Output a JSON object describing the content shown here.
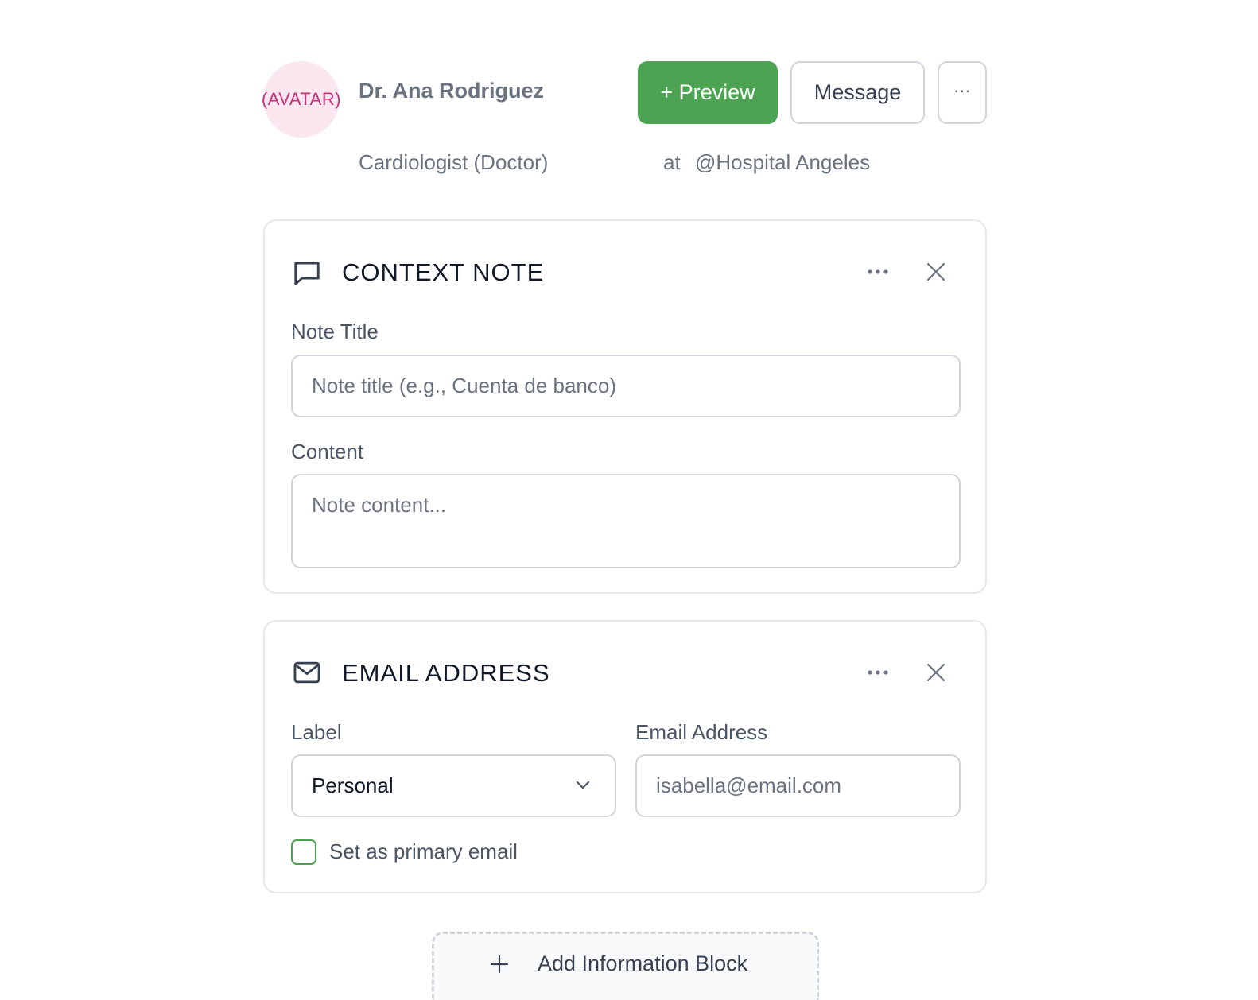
{
  "profile": {
    "avatar_text": "(AVATAR)",
    "name": "Dr. Ana Rodriguez",
    "role": "Cardiologist (Doctor)",
    "at_label": "at",
    "organization": "@Hospital Angeles"
  },
  "actions": {
    "preview_label": "+ Preview",
    "message_label": "Message",
    "more_label": "···"
  },
  "context_note": {
    "title": "CONTEXT NOTE",
    "icon": "message-square-icon",
    "note_title_label": "Note Title",
    "note_title_placeholder": "Note title (e.g., Cuenta de banco)",
    "note_title_value": "",
    "content_label": "Content",
    "content_placeholder": "Note content...",
    "content_value": ""
  },
  "email_block": {
    "title": "EMAIL ADDRESS",
    "icon": "mail-icon",
    "label_field_label": "Label",
    "label_value": "Personal",
    "email_field_label": "Email Address",
    "email_placeholder": "isabella@email.com",
    "email_value": "",
    "primary_checkbox_label": "Set as primary email",
    "primary_checked": false
  },
  "add_block": {
    "label": "Add Information Block"
  },
  "colors": {
    "accent_green": "#4ca452",
    "avatar_bg": "#fbe7f0",
    "avatar_text": "#c8307a"
  }
}
